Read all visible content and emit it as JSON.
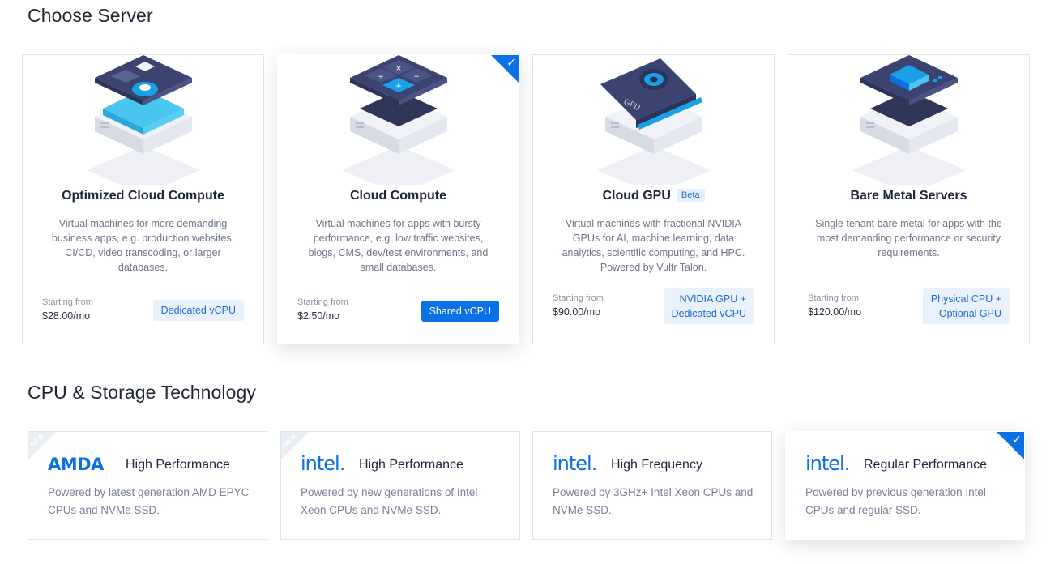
{
  "sections": {
    "server_title": "Choose Server",
    "cpu_title": "CPU & Storage Technology"
  },
  "servers": [
    {
      "title": "Optimized Cloud Compute",
      "description": "Virtual machines for more demanding business apps, e.g. production websites, CI/CD, video transcoding, or larger databases.",
      "starting_label": "Starting from",
      "price": "$28.00/mo",
      "tag": "Dedicated vCPU",
      "selected": false,
      "icon": "optimized-compute-icon"
    },
    {
      "title": "Cloud Compute",
      "description": "Virtual machines for apps with bursty performance, e.g. low traffic websites, blogs, CMS, dev/test environments, and small databases.",
      "starting_label": "Starting from",
      "price": "$2.50/mo",
      "tag": "Shared vCPU",
      "selected": true,
      "icon": "cloud-compute-icon"
    },
    {
      "title": "Cloud GPU",
      "badge": "Beta",
      "description": "Virtual machines with fractional NVIDIA GPUs for AI, machine learning, data analytics, scientific computing, and HPC. Powered by Vultr Talon.",
      "starting_label": "Starting from",
      "price": "$90.00/mo",
      "tag_line1": "NVIDIA GPU +",
      "tag_line2": "Dedicated vCPU",
      "selected": false,
      "icon": "gpu-icon",
      "gpu_label": "GPU"
    },
    {
      "title": "Bare Metal Servers",
      "description": "Single tenant bare metal for apps with the most demanding performance or security requirements.",
      "starting_label": "Starting from",
      "price": "$120.00/mo",
      "tag_line1": "Physical CPU +",
      "tag_line2": "Optional GPU",
      "selected": false,
      "icon": "bare-metal-icon"
    }
  ],
  "cpus": [
    {
      "brand": "AMDA",
      "new_label": "NEW",
      "title": "High Performance",
      "description": "Powered by latest generation AMD EPYC CPUs and NVMe SSD."
    },
    {
      "brand": "intel.",
      "new_label": "NEW",
      "title": "High Performance",
      "description": "Powered by new generations of Intel Xeon CPUs and NVMe SSD."
    },
    {
      "brand": "intel.",
      "title": "High Frequency",
      "description": "Powered by 3GHz+ Intel Xeon CPUs and NVMe SSD."
    },
    {
      "brand": "intel.",
      "title": "Regular Performance",
      "description": "Powered by previous generation Intel CPUs and regular SSD.",
      "selected": true
    }
  ],
  "icons": {
    "check": "✓"
  },
  "colors": {
    "accent": "#0b6fe6",
    "tag_bg": "#e8f1fc",
    "title": "#1c2440",
    "muted": "#6d7588"
  }
}
